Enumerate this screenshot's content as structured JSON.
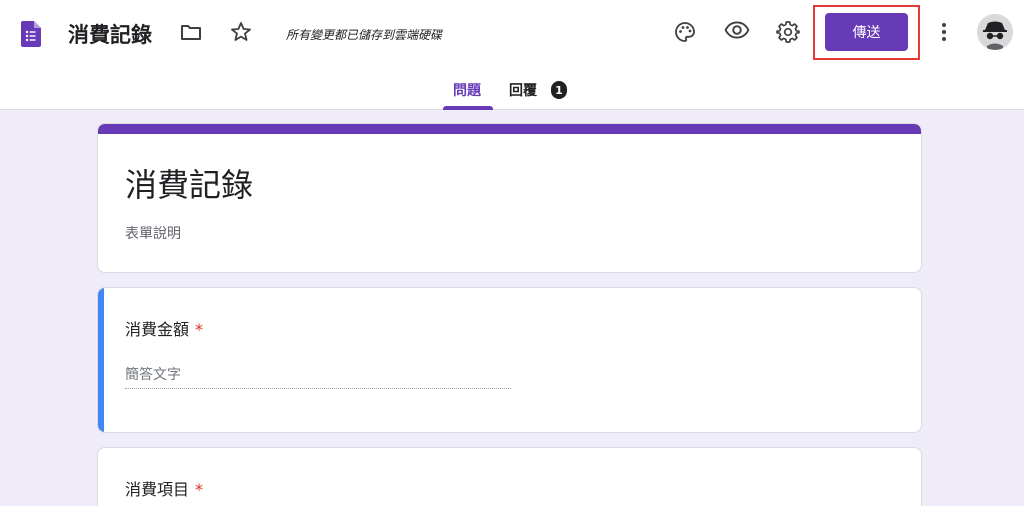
{
  "header": {
    "title": "消費記錄",
    "save_status": "所有變更都已儲存到雲端硬碟",
    "send_label": "傳送"
  },
  "tabs": {
    "questions": "問題",
    "responses": "回覆",
    "responses_count": "1"
  },
  "form": {
    "title": "消費記錄",
    "description": "表單說明"
  },
  "questions": [
    {
      "title": "消費金額",
      "required_mark": "*",
      "answer_hint": "簡答文字"
    },
    {
      "title": "消費項目",
      "required_mark": "*"
    }
  ],
  "colors": {
    "accent": "#673ab7",
    "background": "#f0ebf8",
    "active_question_bar": "#4285f4",
    "highlight_box": "#e53935"
  }
}
